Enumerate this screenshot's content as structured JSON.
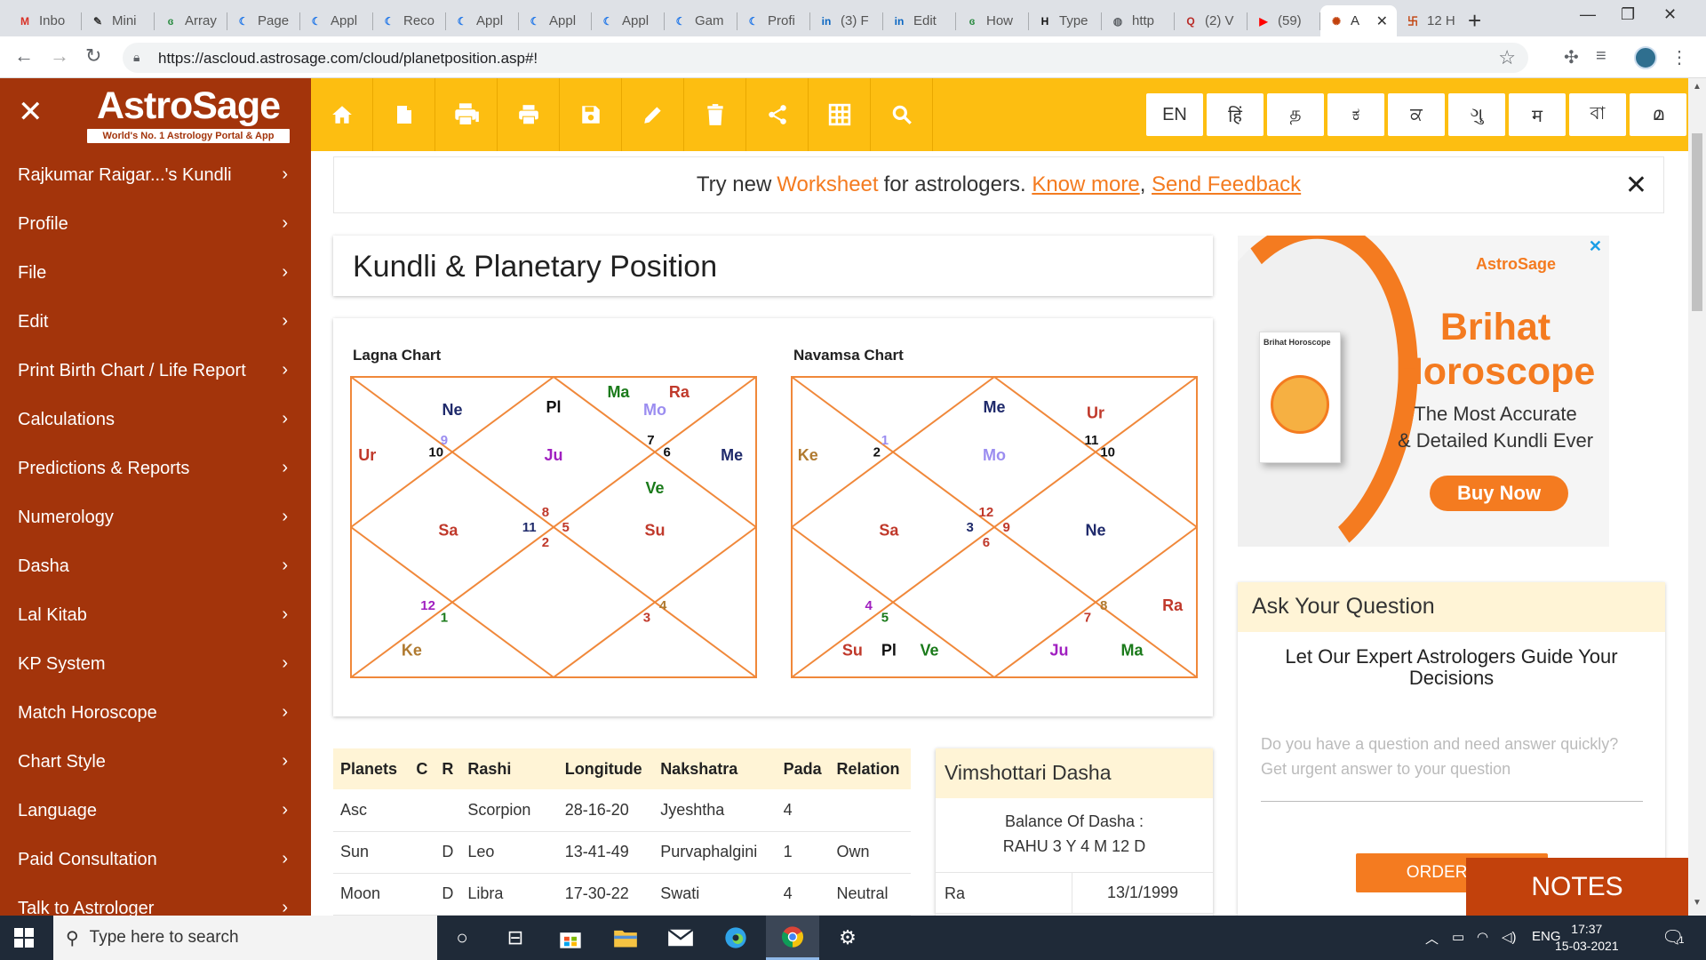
{
  "browser": {
    "tabs": [
      {
        "label": "Inbo",
        "icon": "gmail-icon",
        "color": "#d93025",
        "glyph": "M"
      },
      {
        "label": "Mini",
        "icon": "pen-icon",
        "color": "#333333",
        "glyph": "✎"
      },
      {
        "label": "Array",
        "icon": "gfg-icon",
        "color": "#2f8d46",
        "glyph": "ɞ"
      },
      {
        "label": "Page",
        "icon": "c-icon",
        "color": "#1a73e8",
        "glyph": "☾"
      },
      {
        "label": "Appl",
        "icon": "c-icon",
        "color": "#1a73e8",
        "glyph": "☾"
      },
      {
        "label": "Reco",
        "icon": "c-icon",
        "color": "#1a73e8",
        "glyph": "☾"
      },
      {
        "label": "Appl",
        "icon": "c-icon",
        "color": "#1a73e8",
        "glyph": "☾"
      },
      {
        "label": "Appl",
        "icon": "c-icon",
        "color": "#1a73e8",
        "glyph": "☾"
      },
      {
        "label": "Appl",
        "icon": "c-icon",
        "color": "#1a73e8",
        "glyph": "☾"
      },
      {
        "label": "Gam",
        "icon": "c-icon",
        "color": "#1a73e8",
        "glyph": "☾"
      },
      {
        "label": "Profi",
        "icon": "c-icon",
        "color": "#1a73e8",
        "glyph": "☾"
      },
      {
        "label": "(3) F",
        "icon": "linkedin-icon",
        "color": "#0a66c2",
        "glyph": "in"
      },
      {
        "label": "Edit",
        "icon": "linkedin-icon",
        "color": "#0a66c2",
        "glyph": "in"
      },
      {
        "label": "How",
        "icon": "gfg-icon",
        "color": "#2f8d46",
        "glyph": "ɞ"
      },
      {
        "label": "Type",
        "icon": "hackerrank-icon",
        "color": "#111111",
        "glyph": "H"
      },
      {
        "label": "http",
        "icon": "globe-icon",
        "color": "#5f6368",
        "glyph": "◍"
      },
      {
        "label": "(2) V",
        "icon": "quora-icon",
        "color": "#b92b27",
        "glyph": "Q"
      },
      {
        "label": "(59)",
        "icon": "youtube-icon",
        "color": "#ff0000",
        "glyph": "▶"
      },
      {
        "label": "A",
        "icon": "astrosage-icon",
        "color": "#c2410c",
        "glyph": "✺"
      },
      {
        "label": "12 H",
        "icon": "swastik-icon",
        "color": "#c2410c",
        "glyph": "卐"
      }
    ],
    "url": "https://ascloud.astrosage.com/cloud/planetposition.asp#!"
  },
  "sidebar": {
    "logo": "AstroSage",
    "tagline": "World's No. 1 Astrology Portal & App",
    "items": [
      {
        "label": "Rajkumar Raigar...'s Kundli"
      },
      {
        "label": "Profile"
      },
      {
        "label": "File"
      },
      {
        "label": "Edit"
      },
      {
        "label": "Print Birth Chart / Life Report"
      },
      {
        "label": "Calculations"
      },
      {
        "label": "Predictions & Reports"
      },
      {
        "label": "Numerology"
      },
      {
        "label": "Dasha"
      },
      {
        "label": "Lal Kitab"
      },
      {
        "label": "KP System"
      },
      {
        "label": "Match Horoscope"
      },
      {
        "label": "Chart Style"
      },
      {
        "label": "Language"
      },
      {
        "label": "Paid Consultation"
      },
      {
        "label": "Talk to Astrologer"
      }
    ]
  },
  "toolbar": {
    "icons": [
      "home-icon",
      "new-file-icon",
      "print-multiple-icon",
      "print-icon",
      "save-icon",
      "edit-icon",
      "delete-icon",
      "share-icon",
      "grid-icon",
      "search-icon"
    ],
    "languages": [
      "EN",
      "हिं",
      "த",
      "ಕ",
      "ਕ",
      "ગુ",
      "म",
      "বা",
      "മ"
    ]
  },
  "banner": {
    "text1": "Try new",
    "worksheet": "Worksheet",
    "text2": "for astrologers.",
    "know_more": "Know more",
    "comma": ",",
    "feedback": "Send Feedback"
  },
  "page": {
    "title": "Kundli & Planetary Position"
  },
  "charts": {
    "lagna": {
      "title": "Lagna Chart",
      "labels": [
        {
          "t": "Ne",
          "c": "#1f2a6b"
        },
        {
          "t": "Pl",
          "c": "#111111"
        },
        {
          "t": "Ma",
          "c": "#1a7a1a"
        },
        {
          "t": "Ra",
          "c": "#c0392b"
        },
        {
          "t": "Mo",
          "c": "#9b8df0"
        },
        {
          "t": "Ur",
          "c": "#c0392b"
        },
        {
          "t": "Ju",
          "c": "#a020c0"
        },
        {
          "t": "Me",
          "c": "#1f2a6b"
        },
        {
          "t": "Ve",
          "c": "#1a7a1a"
        },
        {
          "t": "Sa",
          "c": "#c0392b"
        },
        {
          "t": "Su",
          "c": "#c0392b"
        },
        {
          "t": "Ke",
          "c": "#b07a30"
        }
      ],
      "numbers": [
        {
          "t": "9",
          "c": "#9b8df0"
        },
        {
          "t": "10",
          "c": "#111111"
        },
        {
          "t": "7",
          "c": "#111111"
        },
        {
          "t": "6",
          "c": "#111111"
        },
        {
          "t": "8",
          "c": "#c0392b"
        },
        {
          "t": "11",
          "c": "#1f2a6b"
        },
        {
          "t": "5",
          "c": "#c0392b"
        },
        {
          "t": "2",
          "c": "#c0392b"
        },
        {
          "t": "12",
          "c": "#a020c0"
        },
        {
          "t": "1",
          "c": "#1a7a1a"
        },
        {
          "t": "4",
          "c": "#b07a30"
        },
        {
          "t": "3",
          "c": "#c0392b"
        }
      ]
    },
    "navamsa": {
      "title": "Navamsa Chart",
      "labels": [
        {
          "t": "Me",
          "c": "#1f2a6b"
        },
        {
          "t": "Ur",
          "c": "#c0392b"
        },
        {
          "t": "Ke",
          "c": "#b07a30"
        },
        {
          "t": "Mo",
          "c": "#9b8df0"
        },
        {
          "t": "Sa",
          "c": "#c0392b"
        },
        {
          "t": "Ne",
          "c": "#1f2a6b"
        },
        {
          "t": "Ra",
          "c": "#c0392b"
        },
        {
          "t": "Su",
          "c": "#c0392b"
        },
        {
          "t": "Pl",
          "c": "#111111"
        },
        {
          "t": "Ve",
          "c": "#1a7a1a"
        },
        {
          "t": "Ju",
          "c": "#a020c0"
        },
        {
          "t": "Ma",
          "c": "#1a7a1a"
        }
      ],
      "numbers": [
        {
          "t": "1",
          "c": "#9b8df0"
        },
        {
          "t": "2",
          "c": "#111111"
        },
        {
          "t": "11",
          "c": "#111111"
        },
        {
          "t": "10",
          "c": "#111111"
        },
        {
          "t": "12",
          "c": "#c0392b"
        },
        {
          "t": "3",
          "c": "#1f2a6b"
        },
        {
          "t": "9",
          "c": "#c0392b"
        },
        {
          "t": "6",
          "c": "#c0392b"
        },
        {
          "t": "4",
          "c": "#a020c0"
        },
        {
          "t": "5",
          "c": "#1a7a1a"
        },
        {
          "t": "8",
          "c": "#b07a30"
        },
        {
          "t": "7",
          "c": "#c0392b"
        }
      ]
    }
  },
  "planets": {
    "headers": [
      "Planets",
      "C",
      "R",
      "Rashi",
      "Longitude",
      "Nakshatra",
      "Pada",
      "Relation"
    ],
    "rows": [
      [
        "Asc",
        "",
        "",
        "Scorpion",
        "28-16-20",
        "Jyeshtha",
        "4",
        ""
      ],
      [
        "Sun",
        "",
        "D",
        "Leo",
        "13-41-49",
        "Purvaphalgini",
        "1",
        "Own"
      ],
      [
        "Moon",
        "",
        "D",
        "Libra",
        "17-30-22",
        "Swati",
        "4",
        "Neutral"
      ]
    ]
  },
  "dasha": {
    "title": "Vimshottari Dasha",
    "balance_label": "Balance Of Dasha :",
    "balance_value": "RAHU 3 Y 4 M 12 D",
    "rows": [
      [
        "Ra",
        "13/1/1999"
      ]
    ]
  },
  "ad": {
    "brand": "AstroSage",
    "book_title": "Brihat Horoscope",
    "headline1": "Brihat",
    "headline2": "Horoscope",
    "sub1": "The Most Accurate",
    "sub2": "& Detailed Kundli Ever",
    "cta": "Buy Now"
  },
  "ask": {
    "title": "Ask Your Question",
    "guide": "Let Our Expert Astrologers Guide Your Decisions",
    "placeholder1": "Do you have a question and need answer quickly?",
    "placeholder2": "Get urgent answer to your question",
    "order": "ORDER NO",
    "notes": "NOTES"
  },
  "taskbar": {
    "search": "Type here to search",
    "lang": "ENG",
    "time": "17:37",
    "date": "15-03-2021",
    "notif": "1"
  }
}
